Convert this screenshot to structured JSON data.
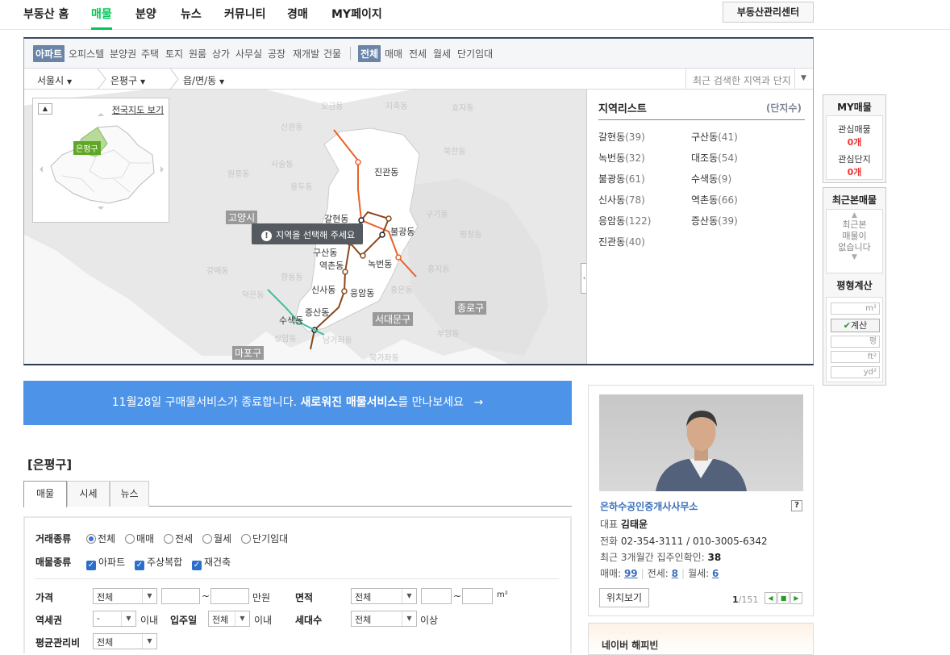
{
  "topnav": {
    "items": [
      "부동산 홈",
      "매물",
      "분양",
      "뉴스",
      "커뮤니티",
      "경매",
      "MY페이지"
    ],
    "active": "매물",
    "center_button": "부동산관리센터"
  },
  "typebar": {
    "types": [
      "아파트",
      "오피스텔",
      "분양권",
      "주택",
      "토지",
      "원룸",
      "상가",
      "사무실",
      "공장",
      "재개발",
      "건물"
    ],
    "deals": [
      "전체",
      "매매",
      "전세",
      "월세",
      "단기임대"
    ]
  },
  "regionbar": {
    "city": "서울시",
    "gu": "은평구",
    "dong": "읍/면/동",
    "recent_placeholder": "최근 검색한 지역과 단지"
  },
  "map": {
    "minimap_link": "전국지도 보기",
    "minimap_selected": "은평구",
    "tooltip": "지역을 선택해 주세요",
    "labels": {
      "jingwan": "진관동",
      "galhyeon": "갈현동",
      "bulgwang": "불광동",
      "gusan": "구산동",
      "yeokchon": "역촌동",
      "nokbeon": "녹번동",
      "sinsa": "신사동",
      "eungam": "응암동",
      "jeungsan": "증산동",
      "suseak": "수색동",
      "goyang": "고양시",
      "seodaemun": "서대문구",
      "jongno": "종로구",
      "mapo": "마포구"
    },
    "bg_labels": [
      "오금동",
      "지축동",
      "효자동",
      "신원동",
      "북한동",
      "사술동",
      "원흥동",
      "용두동",
      "구기동",
      "평창동",
      "홍지동",
      "강매동",
      "향동동",
      "덕은동",
      "홍은동",
      "부암동",
      "상암동",
      "남가좌동",
      "북가좌동"
    ]
  },
  "region_list": {
    "title": "지역리스트",
    "unit": "(단지수)",
    "items": [
      {
        "name": "갈현동",
        "count": "(39)"
      },
      {
        "name": "구산동",
        "count": "(41)"
      },
      {
        "name": "녹번동",
        "count": "(32)"
      },
      {
        "name": "대조동",
        "count": "(54)"
      },
      {
        "name": "불광동",
        "count": "(61)"
      },
      {
        "name": "수색동",
        "count": "(9)"
      },
      {
        "name": "신사동",
        "count": "(78)"
      },
      {
        "name": "역촌동",
        "count": "(66)"
      },
      {
        "name": "응암동",
        "count": "(122)"
      },
      {
        "name": "증산동",
        "count": "(39)"
      },
      {
        "name": "진관동",
        "count": "(40)"
      }
    ]
  },
  "my_box": {
    "title": "MY매물",
    "interest_label": "관심매물",
    "interest_value": "0개",
    "complex_label": "관심단지",
    "complex_value": "0개"
  },
  "recent_box": {
    "title": "최근본매물",
    "empty_line1": "최근본",
    "empty_line2": "매물이",
    "empty_line3": "없습니다",
    "calc_title": "평형계산",
    "unit_m2": "m²",
    "calc_button": "계산",
    "unit_pyeong": "평",
    "unit_ft": "ft²",
    "unit_yd": "yd²"
  },
  "banner": {
    "text_plain": "11월28일 구매물서비스가 종료합니다.",
    "text_bold": "새로워진 매물서비스",
    "text_tail": "를 만나보세요",
    "arrow": "→"
  },
  "section": {
    "title": "[은평구]",
    "tabs": [
      "매물",
      "시세",
      "뉴스"
    ]
  },
  "filter": {
    "deal_label": "거래종류",
    "deal_options": [
      "전체",
      "매매",
      "전세",
      "월세",
      "단기임대"
    ],
    "type_label": "매물종류",
    "type_options": [
      "아파트",
      "주상복합",
      "재건축"
    ],
    "price_label": "가격",
    "price_select": "전체",
    "price_unit": "만원",
    "tilde": "~",
    "area_label": "면적",
    "area_select": "전체",
    "area_unit": "m²",
    "station_label": "역세권",
    "station_select": "-",
    "within": "이내",
    "movein_label": "입주일",
    "movein_select": "전체",
    "households_label": "세대수",
    "households_select": "전체",
    "above": "이상",
    "fee_label": "평균관리비",
    "fee_select": "전체"
  },
  "agent": {
    "name": "은하수공인중개사사무소",
    "help": "?",
    "rep_label": "대표",
    "rep_name": "김태윤",
    "phone_label": "전화",
    "phone": "02-354-3111 / 010-3005-6342",
    "confirm_label": "최근 3개월간 집주인확인:",
    "confirm_value": "38",
    "sale_label": "매매:",
    "sale_value": "99",
    "jeonse_label": "전세:",
    "jeonse_value": "8",
    "monthly_label": "월세:",
    "monthly_value": "6",
    "location_button": "위치보기",
    "page_current": "1",
    "page_total": "/151"
  },
  "happy": {
    "title": "네이버 해피빈"
  },
  "colors": {
    "active_green": "#03c75a",
    "banner_blue": "#4d94e8",
    "link_blue": "#3b6fba",
    "line3_orange": "#e8622c",
    "line6_brown": "#8a4a1c",
    "gyeongui_teal": "#3dbf9f"
  }
}
